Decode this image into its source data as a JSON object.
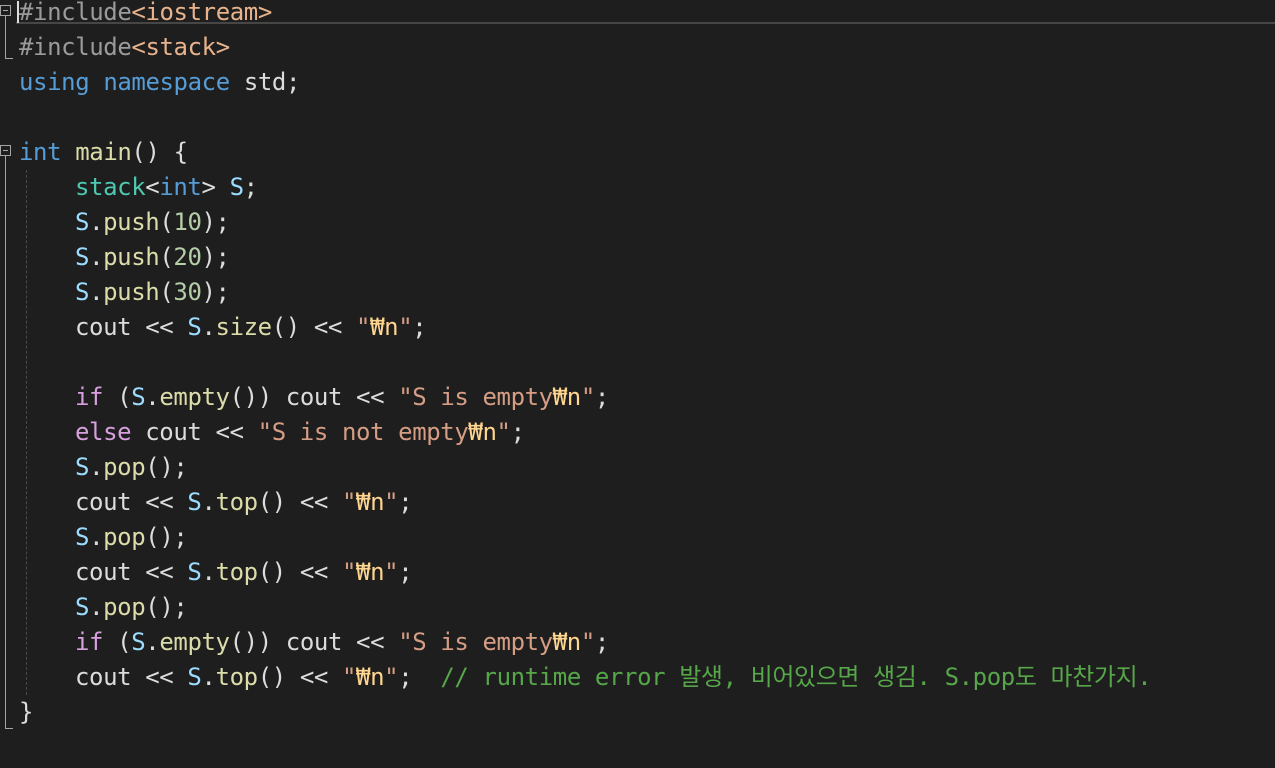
{
  "editor": {
    "lines": [
      {
        "i": "",
        "parts": [
          {
            "t": "#include",
            "c": "pp"
          },
          {
            "t": "<iostream>",
            "c": "inc"
          }
        ]
      },
      {
        "i": "",
        "parts": [
          {
            "t": "#include",
            "c": "pp"
          },
          {
            "t": "<stack>",
            "c": "inc"
          }
        ]
      },
      {
        "i": "",
        "parts": [
          {
            "t": "using",
            "c": "kw"
          },
          {
            "t": " ",
            "c": "txt"
          },
          {
            "t": "namespace",
            "c": "kw"
          },
          {
            "t": " std;",
            "c": "txt"
          }
        ]
      },
      {
        "i": "",
        "parts": []
      },
      {
        "i": "",
        "parts": [
          {
            "t": "int",
            "c": "kw"
          },
          {
            "t": " ",
            "c": "txt"
          },
          {
            "t": "main",
            "c": "fn"
          },
          {
            "t": "() {",
            "c": "txt"
          }
        ]
      },
      {
        "i": "1",
        "parts": [
          {
            "t": "stack",
            "c": "type"
          },
          {
            "t": "<",
            "c": "txt"
          },
          {
            "t": "int",
            "c": "kw"
          },
          {
            "t": "> ",
            "c": "txt"
          },
          {
            "t": "S",
            "c": "var"
          },
          {
            "t": ";",
            "c": "txt"
          }
        ]
      },
      {
        "i": "1",
        "parts": [
          {
            "t": "S",
            "c": "var"
          },
          {
            "t": ".",
            "c": "txt"
          },
          {
            "t": "push",
            "c": "fn"
          },
          {
            "t": "(",
            "c": "txt"
          },
          {
            "t": "10",
            "c": "num"
          },
          {
            "t": ");",
            "c": "txt"
          }
        ]
      },
      {
        "i": "1",
        "parts": [
          {
            "t": "S",
            "c": "var"
          },
          {
            "t": ".",
            "c": "txt"
          },
          {
            "t": "push",
            "c": "fn"
          },
          {
            "t": "(",
            "c": "txt"
          },
          {
            "t": "20",
            "c": "num"
          },
          {
            "t": ");",
            "c": "txt"
          }
        ]
      },
      {
        "i": "1",
        "parts": [
          {
            "t": "S",
            "c": "var"
          },
          {
            "t": ".",
            "c": "txt"
          },
          {
            "t": "push",
            "c": "fn"
          },
          {
            "t": "(",
            "c": "txt"
          },
          {
            "t": "30",
            "c": "num"
          },
          {
            "t": ");",
            "c": "txt"
          }
        ]
      },
      {
        "i": "1",
        "parts": [
          {
            "t": "cout",
            "c": "txt"
          },
          {
            "t": " << ",
            "c": "txt"
          },
          {
            "t": "S",
            "c": "var"
          },
          {
            "t": ".",
            "c": "txt"
          },
          {
            "t": "size",
            "c": "fn"
          },
          {
            "t": "() << ",
            "c": "txt"
          },
          {
            "t": "\"",
            "c": "str"
          },
          {
            "t": "₩n",
            "c": "esc"
          },
          {
            "t": "\"",
            "c": "str"
          },
          {
            "t": ";",
            "c": "txt"
          }
        ]
      },
      {
        "i": "",
        "parts": []
      },
      {
        "i": "1",
        "parts": [
          {
            "t": "if",
            "c": "kw2"
          },
          {
            "t": " (",
            "c": "txt"
          },
          {
            "t": "S",
            "c": "var"
          },
          {
            "t": ".",
            "c": "txt"
          },
          {
            "t": "empty",
            "c": "fn"
          },
          {
            "t": "()) cout << ",
            "c": "txt"
          },
          {
            "t": "\"S is empty",
            "c": "str"
          },
          {
            "t": "₩n",
            "c": "esc"
          },
          {
            "t": "\"",
            "c": "str"
          },
          {
            "t": ";",
            "c": "txt"
          }
        ]
      },
      {
        "i": "1",
        "parts": [
          {
            "t": "else",
            "c": "kw2"
          },
          {
            "t": " cout << ",
            "c": "txt"
          },
          {
            "t": "\"S is not empty",
            "c": "str"
          },
          {
            "t": "₩n",
            "c": "esc"
          },
          {
            "t": "\"",
            "c": "str"
          },
          {
            "t": ";",
            "c": "txt"
          }
        ]
      },
      {
        "i": "1",
        "parts": [
          {
            "t": "S",
            "c": "var"
          },
          {
            "t": ".",
            "c": "txt"
          },
          {
            "t": "pop",
            "c": "fn"
          },
          {
            "t": "();",
            "c": "txt"
          }
        ]
      },
      {
        "i": "1",
        "parts": [
          {
            "t": "cout",
            "c": "txt"
          },
          {
            "t": " << ",
            "c": "txt"
          },
          {
            "t": "S",
            "c": "var"
          },
          {
            "t": ".",
            "c": "txt"
          },
          {
            "t": "top",
            "c": "fn"
          },
          {
            "t": "() << ",
            "c": "txt"
          },
          {
            "t": "\"",
            "c": "str"
          },
          {
            "t": "₩n",
            "c": "esc"
          },
          {
            "t": "\"",
            "c": "str"
          },
          {
            "t": ";",
            "c": "txt"
          }
        ]
      },
      {
        "i": "1",
        "parts": [
          {
            "t": "S",
            "c": "var"
          },
          {
            "t": ".",
            "c": "txt"
          },
          {
            "t": "pop",
            "c": "fn"
          },
          {
            "t": "();",
            "c": "txt"
          }
        ]
      },
      {
        "i": "1",
        "parts": [
          {
            "t": "cout",
            "c": "txt"
          },
          {
            "t": " << ",
            "c": "txt"
          },
          {
            "t": "S",
            "c": "var"
          },
          {
            "t": ".",
            "c": "txt"
          },
          {
            "t": "top",
            "c": "fn"
          },
          {
            "t": "() << ",
            "c": "txt"
          },
          {
            "t": "\"",
            "c": "str"
          },
          {
            "t": "₩n",
            "c": "esc"
          },
          {
            "t": "\"",
            "c": "str"
          },
          {
            "t": ";",
            "c": "txt"
          }
        ]
      },
      {
        "i": "1",
        "parts": [
          {
            "t": "S",
            "c": "var"
          },
          {
            "t": ".",
            "c": "txt"
          },
          {
            "t": "pop",
            "c": "fn"
          },
          {
            "t": "();",
            "c": "txt"
          }
        ]
      },
      {
        "i": "1",
        "parts": [
          {
            "t": "if",
            "c": "kw2"
          },
          {
            "t": " (",
            "c": "txt"
          },
          {
            "t": "S",
            "c": "var"
          },
          {
            "t": ".",
            "c": "txt"
          },
          {
            "t": "empty",
            "c": "fn"
          },
          {
            "t": "()) cout << ",
            "c": "txt"
          },
          {
            "t": "\"S is empty",
            "c": "str"
          },
          {
            "t": "₩n",
            "c": "esc"
          },
          {
            "t": "\"",
            "c": "str"
          },
          {
            "t": ";",
            "c": "txt"
          }
        ]
      },
      {
        "i": "1",
        "parts": [
          {
            "t": "cout",
            "c": "txt"
          },
          {
            "t": " << ",
            "c": "txt"
          },
          {
            "t": "S",
            "c": "var"
          },
          {
            "t": ".",
            "c": "txt"
          },
          {
            "t": "top",
            "c": "fn"
          },
          {
            "t": "() << ",
            "c": "txt"
          },
          {
            "t": "\"",
            "c": "str"
          },
          {
            "t": "₩n",
            "c": "esc"
          },
          {
            "t": "\"",
            "c": "str"
          },
          {
            "t": ";  ",
            "c": "txt"
          },
          {
            "t": "// runtime error 발생, 비어있으면 생김. S.pop도 마찬가지.",
            "c": "cm"
          }
        ]
      },
      {
        "i": "",
        "parts": [
          {
            "t": "}",
            "c": "txt"
          }
        ]
      }
    ]
  },
  "colors": {
    "background": "#1e1e1e",
    "keyword": "#569cd6",
    "control_keyword": "#d8a0df",
    "type": "#4ec9b0",
    "function": "#dcdcaa",
    "variable": "#9cdcfe",
    "number": "#b5cea8",
    "string": "#d69d85",
    "escape": "#ffd68f",
    "comment": "#57a64a",
    "preprocessor": "#9b9b9b",
    "text": "#dcdcdc"
  },
  "icons": {
    "fold_toggle": "collapse-minus-icon"
  }
}
